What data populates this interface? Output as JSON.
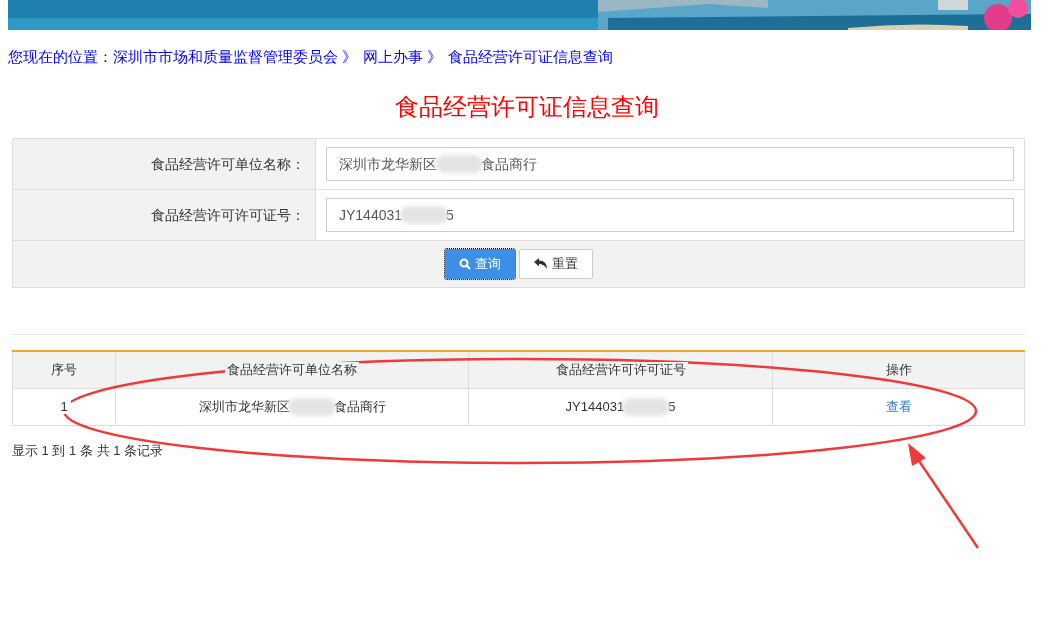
{
  "breadcrumb": {
    "prefix": "您现在的位置：",
    "links": [
      "深圳市市场和质量监督管理委员会 》",
      "网上办事 》",
      "食品经营许可证信息查询"
    ]
  },
  "page_title": "食品经营许可证信息查询",
  "form": {
    "fields": [
      {
        "label": "食品经营许可单位名称：",
        "value_parts": [
          "深圳市龙华新区",
          "食品商行"
        ]
      },
      {
        "label": "食品经营许可许可证号：",
        "value_parts": [
          "JY144031",
          "5"
        ]
      }
    ],
    "buttons": [
      {
        "kind": "search",
        "label": "查询",
        "focused": true
      },
      {
        "kind": "reset",
        "label": "重置",
        "focused": false
      }
    ]
  },
  "table": {
    "columns": [
      "序号",
      "食品经营许可单位名称",
      "食品经营许可许可证号",
      "操作"
    ],
    "rows": [
      {
        "index": "1",
        "name_parts": [
          "深圳市龙华新区",
          "食品商行"
        ],
        "license_parts": [
          "JY144031",
          "5"
        ],
        "action": "查看"
      }
    ]
  },
  "pagination_info": "显示 1 到 1 条 共 1 条记录"
}
